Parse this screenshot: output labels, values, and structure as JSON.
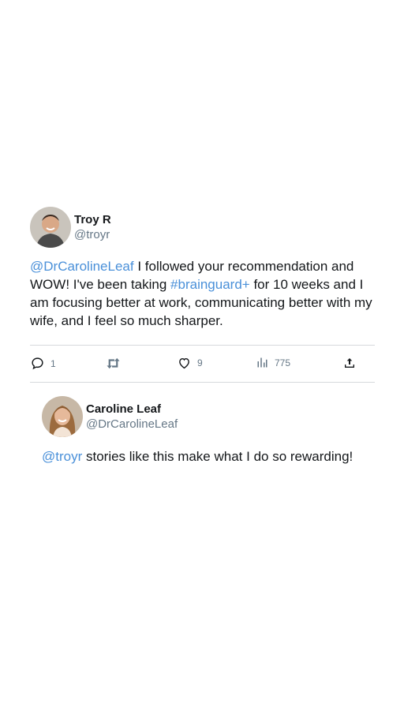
{
  "tweet": {
    "author": {
      "display_name": "Troy R",
      "handle": "@troyr"
    },
    "text": {
      "mention": "@DrCarolineLeaf",
      "part1": " I followed your recommendation and WOW! I've been taking ",
      "hashtag": "#brainguard+",
      "part2": " for 10 weeks and I am focusing better at work, communicating better with my wife, and I feel so much sharper."
    },
    "actions": {
      "replies": "1",
      "likes": "9",
      "views": "775"
    }
  },
  "reply": {
    "author": {
      "display_name": "Caroline Leaf",
      "handle": "@DrCarolineLeaf"
    },
    "text": {
      "mention": "@troyr",
      "part1": " stories like this make what I do so rewarding!"
    }
  },
  "colors": {
    "link": "#4a90d9",
    "muted": "#657786",
    "divider": "#d6d9dc"
  },
  "icons": [
    "reply-icon",
    "retweet-icon",
    "like-icon",
    "views-icon",
    "share-icon"
  ]
}
